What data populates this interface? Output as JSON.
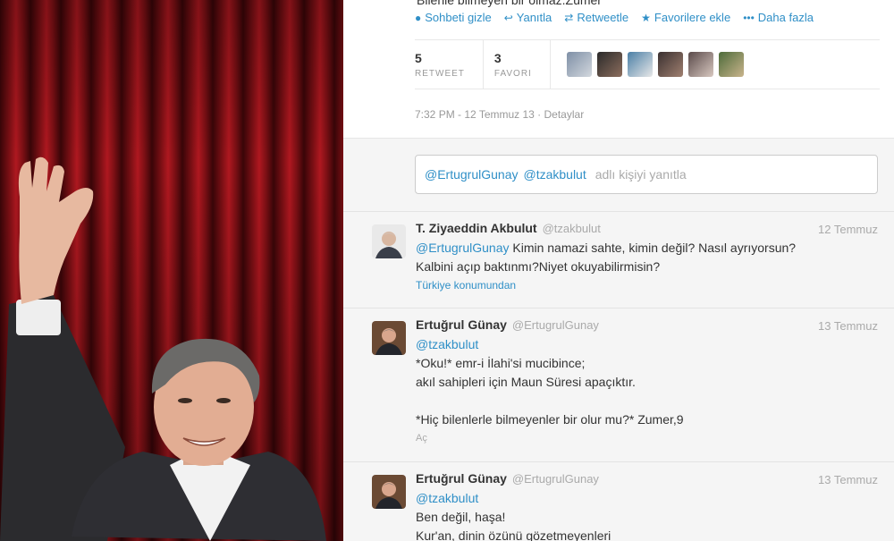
{
  "focused_tweet": {
    "cut_text": "Bilenle bilmeyen bir olmaz.Zümer",
    "actions": [
      {
        "icon": "speech-bubble-icon",
        "label": "Sohbeti gizle"
      },
      {
        "icon": "reply-icon",
        "label": "Yanıtla"
      },
      {
        "icon": "retweet-icon",
        "label": "Retweetle"
      },
      {
        "icon": "star-icon",
        "label": "Favorilere ekle"
      },
      {
        "icon": "more-dots-icon",
        "label": "Daha fazla"
      }
    ],
    "stats": {
      "retweets": "5",
      "retweet_label": "RETWEET",
      "favorites": "3",
      "favorite_label": "FAVORI"
    },
    "timestamp": "7:32 PM - 12 Temmuz 13 · Detaylar"
  },
  "reply_box": {
    "mention1": "@ErtugrulGunay",
    "mention2": "@tzakbulut",
    "placeholder": "adlı kişiyi yanıtla"
  },
  "tweets": [
    {
      "name": "T. Ziyaeddin Akbulut",
      "handle": "@tzakbulut",
      "time": "12 Temmuz",
      "mention": "@ErtugrulGunay",
      "line1": "Kimin namazi sahte, kimin değil? Nasıl ayrıyorsun?",
      "line2": "Kalbini açıp baktınmı?Niyet okuyabilirmisin?",
      "location": "Türkiye konumundan"
    },
    {
      "name": "Ertuğrul Günay",
      "handle": "@ErtugrulGunay",
      "time": "13 Temmuz",
      "mention": "@tzakbulut",
      "line1": "*Oku!* emr-i İlahi'si mucibince;",
      "line2": "akıl sahipleri için Maun Süresi apaçıktır.",
      "line3": "*Hiç bilenlerle bilmeyenler bir olur mu?* Zumer,9",
      "more": "Aç"
    },
    {
      "name": "Ertuğrul Günay",
      "handle": "@ErtugrulGunay",
      "time": "13 Temmuz",
      "mention": "@tzakbulut",
      "line1": "Ben değil, haşa!",
      "line2": "Kur'an, dinin özünü gözetmeyenleri"
    }
  ],
  "colors": {
    "link": "#2f8fc7",
    "curtain": "#b01820",
    "panel_bg": "#f5f5f5"
  }
}
